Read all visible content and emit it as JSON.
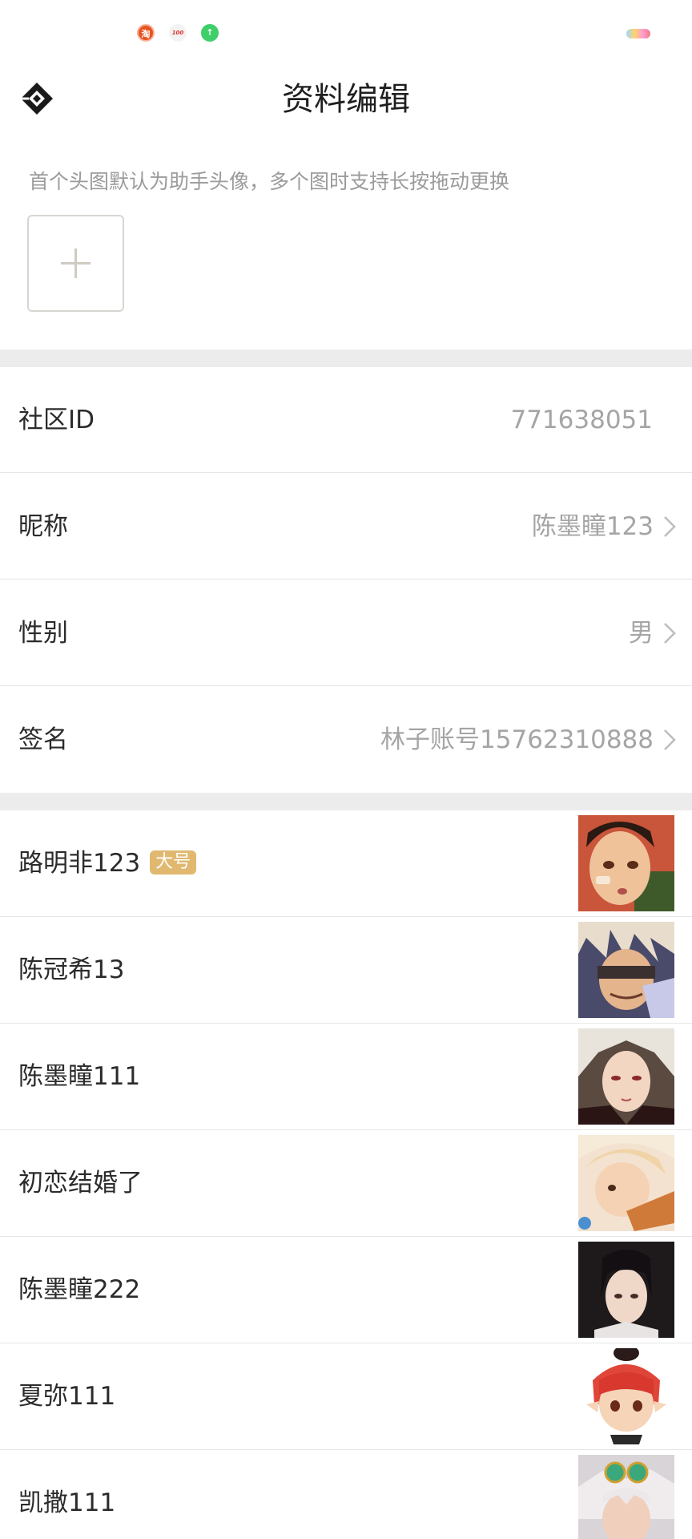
{
  "status_bar": {
    "icons": [
      "taobao-icon",
      "app-100-icon",
      "upload-icon"
    ],
    "taobao_glyph": "淘",
    "app100_glyph": "100",
    "up_glyph": "↑"
  },
  "header": {
    "title": "资料编辑",
    "back_icon": "diamond-back-icon"
  },
  "avatar_section": {
    "hint": "首个头图默认为助手头像，多个图时支持长按拖动更换",
    "add_icon": "plus-icon"
  },
  "profile": {
    "community_id": {
      "label": "社区ID",
      "value": "771638051"
    },
    "nickname": {
      "label": "昵称",
      "value": "陈墨瞳123"
    },
    "gender": {
      "label": "性别",
      "value": "男"
    },
    "signature": {
      "label": "签名",
      "value": "林子账号15762310888"
    }
  },
  "accounts": [
    {
      "name": "路明非123",
      "badge": "大号"
    },
    {
      "name": "陈冠希13",
      "badge": ""
    },
    {
      "name": "陈墨瞳111",
      "badge": ""
    },
    {
      "name": "初恋结婚了",
      "badge": ""
    },
    {
      "name": "陈墨瞳222",
      "badge": ""
    },
    {
      "name": "夏弥111",
      "badge": ""
    },
    {
      "name": "凯撒111",
      "badge": ""
    }
  ],
  "colors": {
    "divider_band": "#ececec",
    "value_text": "#a5a5a5",
    "badge_bg": "#e0b870"
  }
}
